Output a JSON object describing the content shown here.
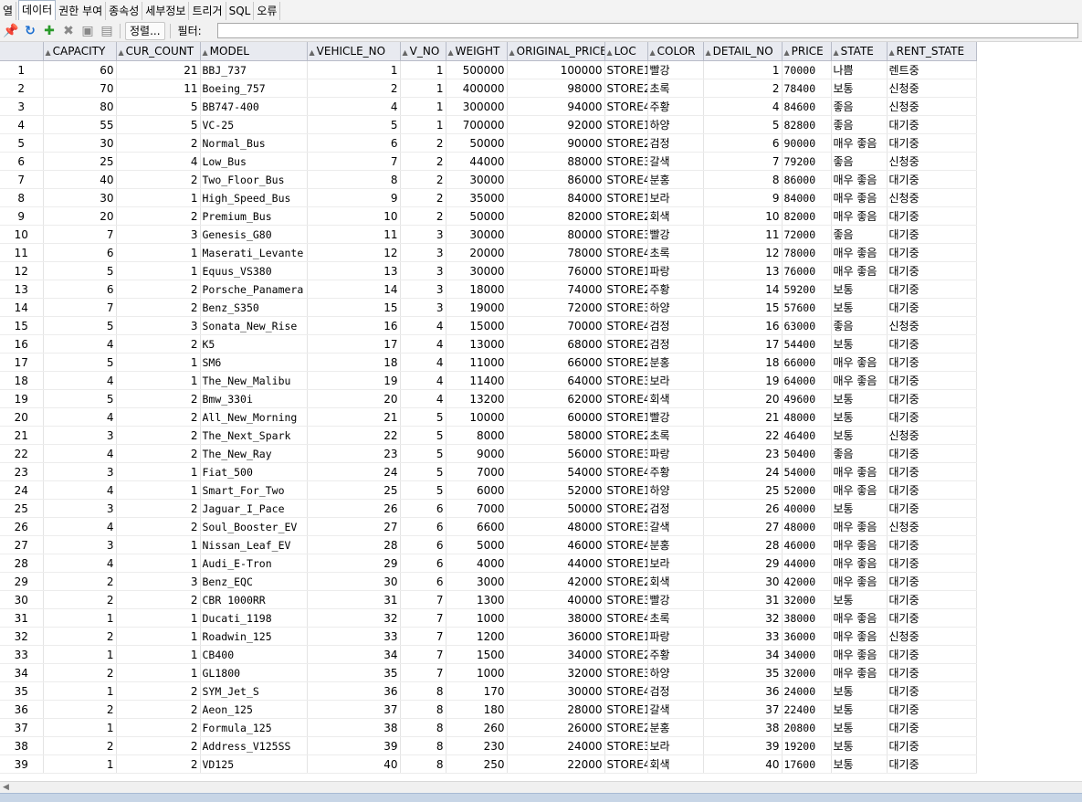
{
  "tabs": [
    "열",
    "데이터",
    "권한 부여",
    "종속성",
    "세부정보",
    "트리거",
    "SQL",
    "오류"
  ],
  "active_tab": 1,
  "toolbar": {
    "sort_label": "정렬...",
    "filter_label": "필터:"
  },
  "columns": [
    "",
    "CAPACITY",
    "CUR_COUNT",
    "MODEL",
    "VEHICLE_NO",
    "V_NO",
    "WEIGHT",
    "ORIGINAL_PRICE",
    "LOC",
    "COLOR",
    "DETAIL_NO",
    "PRICE",
    "STATE",
    "RENT_STATE"
  ],
  "rows": [
    [
      1,
      60,
      21,
      "BBJ_737",
      1,
      1,
      500000,
      100000,
      "STORE1",
      "빨강",
      1,
      70000,
      "나쁨",
      "렌트중"
    ],
    [
      2,
      70,
      11,
      "Boeing_757",
      2,
      1,
      400000,
      98000,
      "STORE2",
      "초록",
      2,
      78400,
      "보통",
      "신청중"
    ],
    [
      3,
      80,
      5,
      "BB747-400",
      4,
      1,
      300000,
      94000,
      "STORE4",
      "주황",
      4,
      84600,
      "좋음",
      "신청중"
    ],
    [
      4,
      55,
      5,
      "VC-25",
      5,
      1,
      700000,
      92000,
      "STORE1",
      "하양",
      5,
      82800,
      "좋음",
      "대기중"
    ],
    [
      5,
      30,
      2,
      "Normal_Bus",
      6,
      2,
      50000,
      90000,
      "STORE2",
      "검정",
      6,
      90000,
      "매우 좋음",
      "대기중"
    ],
    [
      6,
      25,
      4,
      "Low_Bus",
      7,
      2,
      44000,
      88000,
      "STORE3",
      "갈색",
      7,
      79200,
      "좋음",
      "신청중"
    ],
    [
      7,
      40,
      2,
      "Two_Floor_Bus",
      8,
      2,
      30000,
      86000,
      "STORE4",
      "분홍",
      8,
      86000,
      "매우 좋음",
      "대기중"
    ],
    [
      8,
      30,
      1,
      "High_Speed_Bus",
      9,
      2,
      35000,
      84000,
      "STORE1",
      "보라",
      9,
      84000,
      "매우 좋음",
      "신청중"
    ],
    [
      9,
      20,
      2,
      "Premium_Bus",
      10,
      2,
      50000,
      82000,
      "STORE2",
      "회색",
      10,
      82000,
      "매우 좋음",
      "대기중"
    ],
    [
      10,
      7,
      3,
      "Genesis_G80",
      11,
      3,
      30000,
      80000,
      "STORE3",
      "빨강",
      11,
      72000,
      "좋음",
      "대기중"
    ],
    [
      11,
      6,
      1,
      "Maserati_Levante",
      12,
      3,
      20000,
      78000,
      "STORE4",
      "초록",
      12,
      78000,
      "매우 좋음",
      "대기중"
    ],
    [
      12,
      5,
      1,
      "Equus_VS380",
      13,
      3,
      30000,
      76000,
      "STORE1",
      "파랑",
      13,
      76000,
      "매우 좋음",
      "대기중"
    ],
    [
      13,
      6,
      2,
      "Porsche_Panamera",
      14,
      3,
      18000,
      74000,
      "STORE2",
      "주황",
      14,
      59200,
      "보통",
      "대기중"
    ],
    [
      14,
      7,
      2,
      "Benz_S350",
      15,
      3,
      19000,
      72000,
      "STORE3",
      "하양",
      15,
      57600,
      "보통",
      "대기중"
    ],
    [
      15,
      5,
      3,
      "Sonata_New_Rise",
      16,
      4,
      15000,
      70000,
      "STORE4",
      "검정",
      16,
      63000,
      "좋음",
      "신청중"
    ],
    [
      16,
      4,
      2,
      "K5",
      17,
      4,
      13000,
      68000,
      "STORE2",
      "검정",
      17,
      54400,
      "보통",
      "대기중"
    ],
    [
      17,
      5,
      1,
      "SM6",
      18,
      4,
      11000,
      66000,
      "STORE2",
      "분홍",
      18,
      66000,
      "매우 좋음",
      "대기중"
    ],
    [
      18,
      4,
      1,
      "The_New_Malibu",
      19,
      4,
      11400,
      64000,
      "STORE3",
      "보라",
      19,
      64000,
      "매우 좋음",
      "대기중"
    ],
    [
      19,
      5,
      2,
      "Bmw_330i",
      20,
      4,
      13200,
      62000,
      "STORE4",
      "회색",
      20,
      49600,
      "보통",
      "대기중"
    ],
    [
      20,
      4,
      2,
      "All_New_Morning",
      21,
      5,
      10000,
      60000,
      "STORE1",
      "빨강",
      21,
      48000,
      "보통",
      "대기중"
    ],
    [
      21,
      3,
      2,
      "The_Next_Spark",
      22,
      5,
      8000,
      58000,
      "STORE2",
      "초록",
      22,
      46400,
      "보통",
      "신청중"
    ],
    [
      22,
      4,
      2,
      "The_New_Ray",
      23,
      5,
      9000,
      56000,
      "STORE3",
      "파랑",
      23,
      50400,
      "좋음",
      "대기중"
    ],
    [
      23,
      3,
      1,
      "Fiat_500",
      24,
      5,
      7000,
      54000,
      "STORE4",
      "주황",
      24,
      54000,
      "매우 좋음",
      "대기중"
    ],
    [
      24,
      4,
      1,
      "Smart_For_Two",
      25,
      5,
      6000,
      52000,
      "STORE1",
      "하양",
      25,
      52000,
      "매우 좋음",
      "대기중"
    ],
    [
      25,
      3,
      2,
      "Jaguar_I_Pace",
      26,
      6,
      7000,
      50000,
      "STORE2",
      "검정",
      26,
      40000,
      "보통",
      "대기중"
    ],
    [
      26,
      4,
      2,
      "Soul_Booster_EV",
      27,
      6,
      6600,
      48000,
      "STORE3",
      "갈색",
      27,
      48000,
      "매우 좋음",
      "신청중"
    ],
    [
      27,
      3,
      1,
      "Nissan_Leaf_EV",
      28,
      6,
      5000,
      46000,
      "STORE4",
      "분홍",
      28,
      46000,
      "매우 좋음",
      "대기중"
    ],
    [
      28,
      4,
      1,
      "Audi_E-Tron",
      29,
      6,
      4000,
      44000,
      "STORE1",
      "보라",
      29,
      44000,
      "매우 좋음",
      "대기중"
    ],
    [
      29,
      2,
      3,
      "Benz_EQC",
      30,
      6,
      3000,
      42000,
      "STORE2",
      "회색",
      30,
      42000,
      "매우 좋음",
      "대기중"
    ],
    [
      30,
      2,
      2,
      "CBR 1000RR",
      31,
      7,
      1300,
      40000,
      "STORE3",
      "빨강",
      31,
      32000,
      "보통",
      "대기중"
    ],
    [
      31,
      1,
      1,
      "Ducati_1198",
      32,
      7,
      1000,
      38000,
      "STORE4",
      "초록",
      32,
      38000,
      "매우 좋음",
      "대기중"
    ],
    [
      32,
      2,
      1,
      "Roadwin_125",
      33,
      7,
      1200,
      36000,
      "STORE1",
      "파랑",
      33,
      36000,
      "매우 좋음",
      "신청중"
    ],
    [
      33,
      1,
      1,
      "CB400",
      34,
      7,
      1500,
      34000,
      "STORE2",
      "주황",
      34,
      34000,
      "매우 좋음",
      "대기중"
    ],
    [
      34,
      2,
      1,
      "GL1800",
      35,
      7,
      1000,
      32000,
      "STORE3",
      "하양",
      35,
      32000,
      "매우 좋음",
      "대기중"
    ],
    [
      35,
      1,
      2,
      "SYM_Jet_S",
      36,
      8,
      170,
      30000,
      "STORE4",
      "검정",
      36,
      24000,
      "보통",
      "대기중"
    ],
    [
      36,
      2,
      2,
      "Aeon_125",
      37,
      8,
      180,
      28000,
      "STORE1",
      "갈색",
      37,
      22400,
      "보통",
      "대기중"
    ],
    [
      37,
      1,
      2,
      "Formula_125",
      38,
      8,
      260,
      26000,
      "STORE2",
      "분홍",
      38,
      20800,
      "보통",
      "대기중"
    ],
    [
      38,
      2,
      2,
      "Address_V125SS",
      39,
      8,
      230,
      24000,
      "STORE3",
      "보라",
      39,
      19200,
      "보통",
      "대기중"
    ],
    [
      39,
      1,
      2,
      "VD125",
      40,
      8,
      250,
      22000,
      "STORE4",
      "회색",
      40,
      17600,
      "보통",
      "대기중"
    ]
  ]
}
